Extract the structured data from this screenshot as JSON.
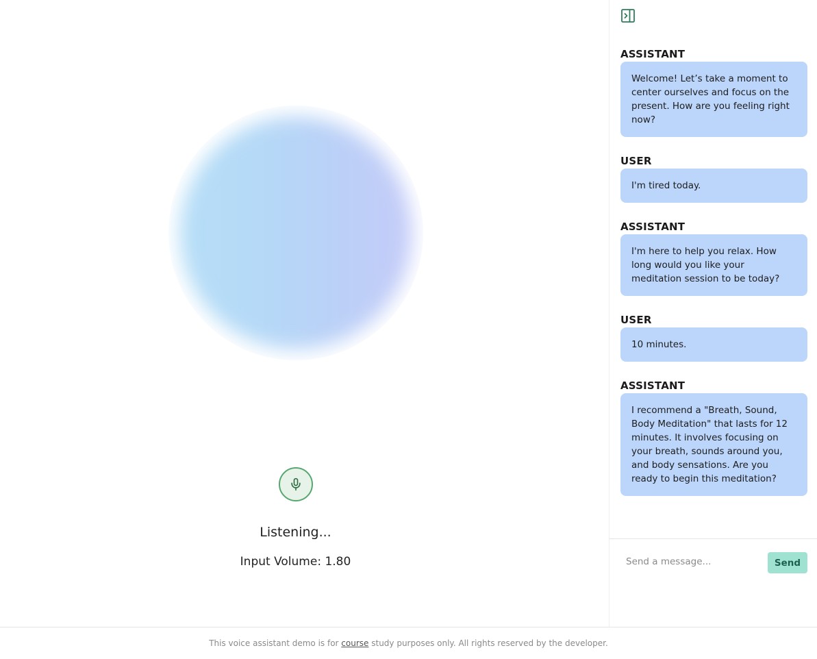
{
  "stage": {
    "status_text": "Listening...",
    "volume_text": "Input Volume: 1.80",
    "mic_icon": "microphone-icon",
    "orb_colors": [
      "#b6def7",
      "#b9d2f7",
      "#c4cbf8"
    ]
  },
  "chat": {
    "toggle_icon": "panel-collapse-icon",
    "messages": [
      {
        "role": "ASSISTANT",
        "text": "Welcome! Let’s take a moment to center ourselves and focus on the present. How are you feeling right now?"
      },
      {
        "role": "USER",
        "text": "I'm tired today."
      },
      {
        "role": "ASSISTANT",
        "text": "I'm here to help you relax. How long would you like your meditation session to be today?"
      },
      {
        "role": "USER",
        "text": "10 minutes."
      },
      {
        "role": "ASSISTANT",
        "text": "I recommend a \"Breath, Sound, Body Meditation\" that lasts for 12 minutes. It involves focusing on your breath, sounds around you, and body sensations. Are you ready to begin this meditation?"
      }
    ],
    "input_placeholder": "Send a message...",
    "input_value": "",
    "send_label": "Send"
  },
  "footer": {
    "prefix": "This voice assistant demo is for ",
    "link_text": "course",
    "suffix": " study purposes only. All rights reserved by the developer."
  },
  "colors": {
    "bubble": "#bcd5fa",
    "mic_border": "#56a870",
    "mic_fill": "#e7f3e9",
    "send_bg": "#9fe2d2",
    "send_text": "#1f5f52",
    "toggle_icon": "#2f7d5b"
  }
}
